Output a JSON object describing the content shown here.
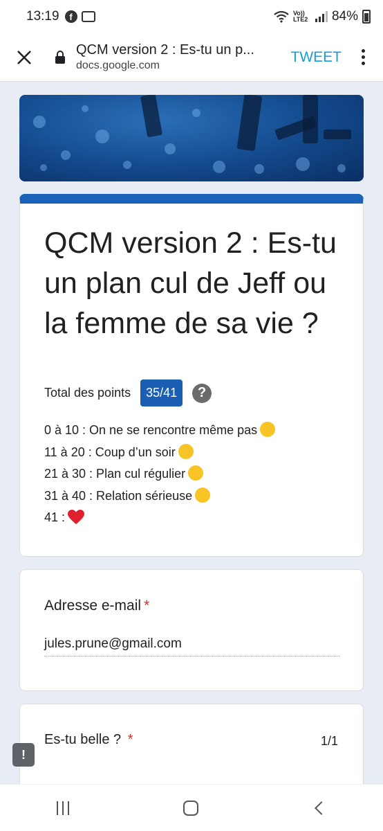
{
  "status_bar": {
    "time": "13:19",
    "network_label": "Vo)) LTE2",
    "battery": "84%"
  },
  "browser": {
    "page_title": "QCM version 2 : Es-tu un p...",
    "domain": "docs.google.com",
    "tweet_label": "TWEET"
  },
  "form": {
    "title": "QCM version 2 : Es-tu un plan cul de Jeff ou la femme de sa vie ?",
    "points_label": "Total des points",
    "score": "35/41",
    "help_symbol": "?",
    "scale": [
      {
        "text": "0 à 10 : On ne se rencontre même pas",
        "emoji": "laughing-face"
      },
      {
        "text": "11 à 20 : Coup d’un soir",
        "emoji": "smirking-face"
      },
      {
        "text": "21 à 30 : Plan cul régulier",
        "emoji": "kissing-face"
      },
      {
        "text": "31 à 40 : Relation sérieuse",
        "emoji": "halo-face"
      },
      {
        "text": "41 :",
        "emoji": "red-heart"
      }
    ]
  },
  "email_question": {
    "label": "Adresse e-mail",
    "required_mark": "*",
    "value": "jules.prune@gmail.com"
  },
  "question_1": {
    "label": "Es-tu belle ?",
    "required_mark": "*",
    "score": "1/1"
  },
  "feedback_symbol": "!",
  "colors": {
    "accent": "#1a63b8",
    "tweet": "#1a9bd7",
    "required": "#d93025",
    "background": "#e8edf5"
  }
}
